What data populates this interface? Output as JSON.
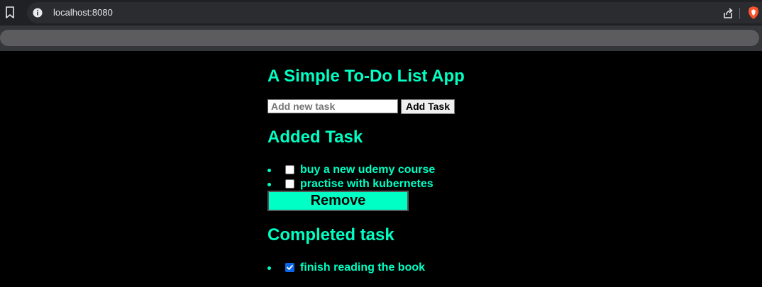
{
  "browser": {
    "url": "localhost:8080"
  },
  "app": {
    "title": "A Simple To-Do List App",
    "input_placeholder": "Add new task",
    "add_button_label": "Add Task",
    "added_heading": "Added Task",
    "added_tasks": [
      {
        "label": "buy a new udemy course",
        "checked": false
      },
      {
        "label": "practise with kubernetes",
        "checked": false
      }
    ],
    "remove_button_label": "Remove",
    "completed_heading": "Completed task",
    "completed_tasks": [
      {
        "label": "finish reading the book",
        "checked": true
      }
    ]
  },
  "colors": {
    "accent": "#00ffc4",
    "background": "#000000",
    "checkbox_checked": "#0a66e8"
  }
}
